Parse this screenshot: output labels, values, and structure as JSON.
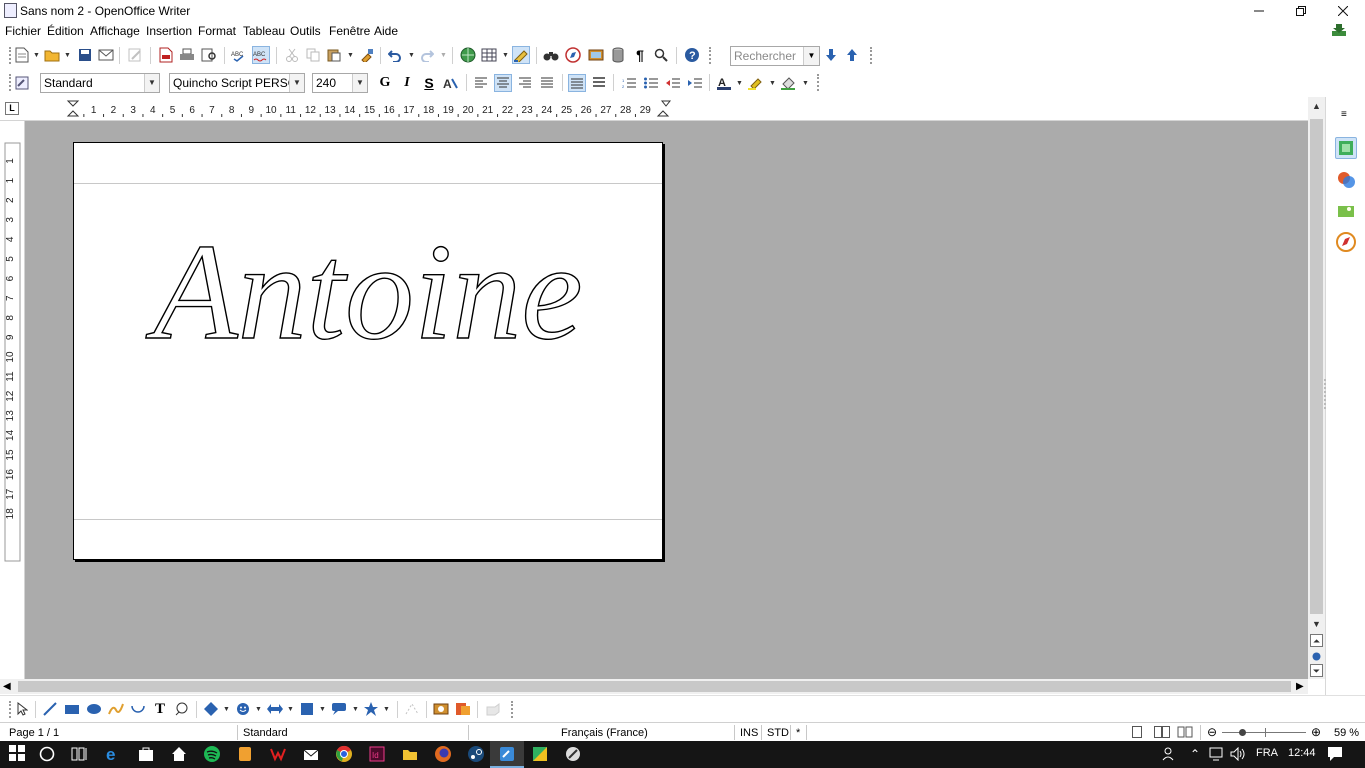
{
  "window": {
    "title": "Sans nom 2 - OpenOffice Writer"
  },
  "menu": [
    "Fichier",
    "Édition",
    "Affichage",
    "Insertion",
    "Format",
    "Tableau",
    "Outils",
    "Fenêtre",
    "Aide"
  ],
  "toolbar": {
    "search_placeholder": "Rechercher",
    "style_value": "Standard",
    "font_value": "Quincho Script PERSONAL",
    "size_value": "240",
    "bold_label": "G",
    "italic_label": "I",
    "underline_label": "S"
  },
  "ruler": {
    "h_marks": [
      "1",
      "2",
      "3",
      "4",
      "5",
      "6",
      "7",
      "8",
      "9",
      "10",
      "11",
      "12",
      "13",
      "14",
      "15",
      "16",
      "17",
      "18",
      "19",
      "20",
      "21",
      "22",
      "23",
      "24",
      "25",
      "26",
      "27",
      "28",
      "29"
    ],
    "v_marks": [
      "1",
      "1",
      "2",
      "3",
      "4",
      "5",
      "6",
      "7",
      "8",
      "9",
      "10",
      "11",
      "12",
      "13",
      "14",
      "15",
      "16",
      "17",
      "18"
    ]
  },
  "document": {
    "text": "Antoine"
  },
  "status": {
    "page": "Page 1 / 1",
    "style": "Standard",
    "language": "Français (France)",
    "insert_mode": "INS",
    "selection_mode": "STD",
    "modified": "*",
    "zoom": "59 %"
  },
  "taskbar": {
    "lang": "FRA",
    "time": "12:44"
  },
  "colors": {
    "accent": "#3c7fb1",
    "workspace": "#ababab",
    "taskbar": "#151515"
  },
  "icons": [
    "new-document-icon",
    "open-folder-icon",
    "save-icon",
    "export-pdf-icon",
    "print-icon",
    "print-preview-icon",
    "spellcheck-icon",
    "autospell-icon",
    "cut-icon",
    "copy-icon",
    "paste-icon",
    "clone-format-icon",
    "undo-icon",
    "redo-icon",
    "hyperlink-icon",
    "table-icon",
    "draw-functions-icon",
    "find-replace-icon",
    "navigator-icon",
    "gallery-icon",
    "data-sources-icon",
    "nonprinting-chars-icon",
    "zoom-icon",
    "help-icon",
    "find-down-icon",
    "find-up-icon"
  ]
}
